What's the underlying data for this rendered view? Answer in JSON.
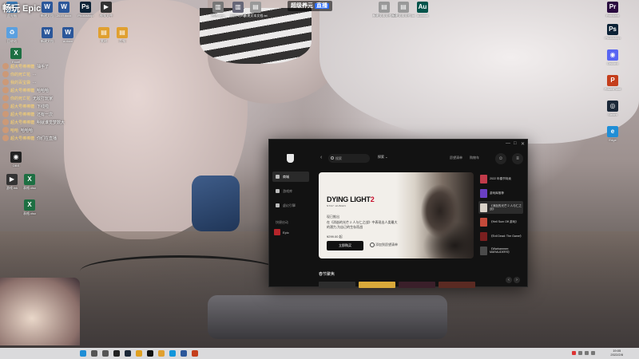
{
  "overlay": {
    "title": "畅玩 Epic",
    "live_badge": "超级养元",
    "live_tag": "直播"
  },
  "desktop_icons": [
    {
      "label": "此电脑",
      "color": "#3b82c4",
      "glyph": "▣"
    },
    {
      "label": "回收站",
      "color": "#5aa0e0",
      "glyph": "♻"
    },
    {
      "label": "新建文档",
      "color": "#2b579a",
      "glyph": "W"
    },
    {
      "label": "新建文档",
      "color": "#2b579a",
      "glyph": "W"
    },
    {
      "label": "Photoshop",
      "color": "#0b2236",
      "glyph": "Ps"
    },
    {
      "label": "视频文件",
      "color": "#333",
      "glyph": "▶"
    },
    {
      "label": "2019.docx",
      "color": "#2b579a",
      "glyph": "W"
    },
    {
      "label": "a.docx",
      "color": "#2b579a",
      "glyph": "W"
    },
    {
      "label": "素材",
      "color": "#e0a030",
      "glyph": "▤"
    },
    {
      "label": "音频",
      "color": "#e0a030",
      "glyph": "▤"
    },
    {
      "label": "图片.png",
      "color": "#777",
      "glyph": "▥"
    },
    {
      "label": "图片1.png",
      "color": "#667",
      "glyph": "▥"
    },
    {
      "label": "新建文本文档.txt",
      "color": "#999",
      "glyph": "▤"
    },
    {
      "label": "新建文本文档.txt",
      "color": "#999",
      "glyph": "▤"
    },
    {
      "label": "新建文本文档.txt",
      "color": "#999",
      "glyph": "▤"
    },
    {
      "label": "Audition",
      "color": "#00534a",
      "glyph": "Au"
    },
    {
      "label": "Premiere",
      "color": "#2a0a3f",
      "glyph": "Pr"
    },
    {
      "label": "Photoshop",
      "color": "#0b2236",
      "glyph": "Ps"
    },
    {
      "label": "Discord",
      "color": "#5865f2",
      "glyph": "◉"
    },
    {
      "label": "PowerPoint",
      "color": "#c43e1c",
      "glyph": "P"
    },
    {
      "label": "Steam",
      "color": "#1b2838",
      "glyph": "◎"
    },
    {
      "label": "Edge",
      "color": "#1f8ed6",
      "glyph": "e"
    },
    {
      "label": "Excel",
      "color": "#1d6f42",
      "glyph": "X"
    },
    {
      "label": "OBS",
      "color": "#222",
      "glyph": "◉"
    },
    {
      "label": "游戏.lnk",
      "color": "#333",
      "glyph": "▶"
    },
    {
      "label": "表格.xlsx",
      "color": "#1d6f42",
      "glyph": "X"
    },
    {
      "label": "表格.xlsx",
      "color": "#1d6f42",
      "glyph": "X"
    }
  ],
  "danmaku": [
    {
      "user": "超大号棒棒糖",
      "text": "抽手了"
    },
    {
      "user": "你的死亡花",
      "text": "..."
    },
    {
      "user": "我的百宝袋",
      "text": "..."
    },
    {
      "user": "超大号棒棒糖",
      "text": "哈哈哈"
    },
    {
      "user": "你的死亡花",
      "text": "无敌打玩家"
    },
    {
      "user": "超大号棒棒糖",
      "text": "下线啦"
    },
    {
      "user": "超大号棒棒糖",
      "text": "还有一次"
    },
    {
      "user": "超大号棒棒糖",
      "text": "明就谁觉梦数大"
    },
    {
      "user": "哈哈",
      "text": "哈哈哈"
    },
    {
      "user": "超大号棒棒糖",
      "text": "你们在直播"
    }
  ],
  "epic": {
    "nav": [
      {
        "label": "商城"
      },
      {
        "label": "游戏库"
      },
      {
        "label": "虚幻引擎"
      }
    ],
    "section_label": "快捷启动",
    "library_item": "Epic",
    "search_placeholder": "搜索",
    "discover_label": "探索",
    "wishlist_label": "愿望清单",
    "cart_label": "购物车",
    "window_controls": [
      "—",
      "□",
      "✕"
    ],
    "hero": {
      "logo_main": "DYING LIGHT",
      "logo_num": "2",
      "logo_sub": "STAY HUMAN",
      "kicker": "现已推出",
      "desc": "在《消逝的光芒 2 人与仁之战》中表现出人类最大的潜力,为自己的生存而战",
      "price": "¥299.00 起",
      "buy_label": "立即购买",
      "wishlist_label": "添加到愿望清单"
    },
    "rail": [
      {
        "label": "2022 年春节特卖",
        "color": "#c13b4a"
      },
      {
        "label": "游戏库推荐",
        "color": "#6a3fc4"
      },
      {
        "label": "《消逝的光芒 2 人与仁之战》",
        "color": "#d9d2c8"
      },
      {
        "label": "《Hell Sum Off 游戏》",
        "color": "#c44a3a"
      },
      {
        "label": "《Evil Dead: The Game》",
        "color": "#7a1f1f"
      },
      {
        "label": "《Warhammer: MARAUDERS》",
        "color": "#4a4a4a"
      }
    ],
    "sale_title": "春节聚焦",
    "thumb_colors": [
      "#2d2d2d",
      "#d8a93a",
      "#3a1f2a",
      "#5a2a22"
    ]
  },
  "taskbar": {
    "time": "19:05",
    "date": "2022/2/8",
    "icons": [
      {
        "name": "windows",
        "color": "#1f8ed6"
      },
      {
        "name": "search",
        "color": "#555"
      },
      {
        "name": "task-view",
        "color": "#555"
      },
      {
        "name": "obs",
        "color": "#222"
      },
      {
        "name": "steam",
        "color": "#1b2838"
      },
      {
        "name": "chrome",
        "color": "#e0a020"
      },
      {
        "name": "epic",
        "color": "#111"
      },
      {
        "name": "folder",
        "color": "#e0a030"
      },
      {
        "name": "qq",
        "color": "#1296db"
      },
      {
        "name": "word",
        "color": "#2b579a"
      },
      {
        "name": "powerpoint",
        "color": "#c43e1c"
      }
    ]
  }
}
